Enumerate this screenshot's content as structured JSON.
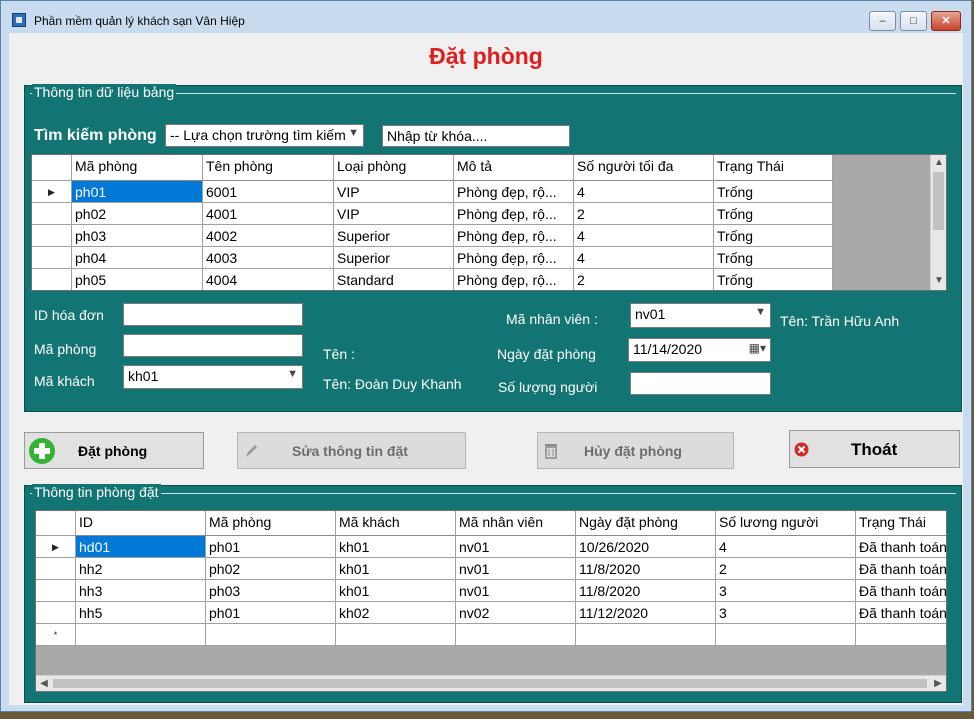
{
  "window": {
    "title": "Phần mềm quản lý khách sạn Vân Hiệp",
    "min": "–",
    "max": "□",
    "close": "✕"
  },
  "heading": "Đặt phòng",
  "group1": {
    "legend": "Thông tin dữ liệu  bảng",
    "search_label": "Tìm kiếm phòng",
    "search_field": "-- Lựa chọn trường tìm kiếm",
    "keyword": "Nhập từ khóa....",
    "rooms": {
      "headers": [
        "Mã phòng",
        "Tên phòng",
        "Loại phòng",
        "Mô tả",
        "Số người tối đa",
        "Trạng Thái"
      ],
      "rows": [
        [
          "ph01",
          "6001",
          "VIP",
          "Phòng đẹp, rộ...",
          "4",
          "Trống"
        ],
        [
          "ph02",
          "4001",
          "VIP",
          "Phòng đẹp, rộ...",
          "2",
          "Trống"
        ],
        [
          "ph03",
          "4002",
          "Superior",
          "Phòng đẹp, rộ...",
          "4",
          "Trống"
        ],
        [
          "ph04",
          "4003",
          "Superior",
          "Phòng đẹp, rộ...",
          "4",
          "Trống"
        ],
        [
          "ph05",
          "4004",
          "Standard",
          "Phòng đẹp, rộ...",
          "2",
          "Trống"
        ]
      ]
    },
    "form": {
      "invoice_id_label": "ID hóa đơn",
      "room_id_label": "Mã phòng",
      "customer_id_label": "Mã khách",
      "customer_id_value": "kh01",
      "room_name_label": "Tên :",
      "customer_name_label": "Tên: Đoàn Duy Khanh",
      "staff_id_label": "Mã nhân viên :",
      "staff_id_value": "nv01",
      "staff_name_label": "Tên: Trần Hữu Anh",
      "booking_date_label": "Ngày đặt phòng",
      "booking_date_value": "11/14/2020",
      "guests_label": "Số lượng người"
    }
  },
  "buttons": {
    "book": "Đặt phòng",
    "edit": "Sửa thông tin đặt",
    "cancel": "Hủy đặt phòng",
    "exit": "Thoát"
  },
  "group2": {
    "legend": "Thông tin phòng đặt",
    "bookings": {
      "headers": [
        "ID",
        "Mã phòng",
        "Mã khách",
        "Mã nhân viên",
        "Ngày đặt phòng",
        "Số lương người",
        "Trạng Thái"
      ],
      "rows": [
        [
          "hd01",
          "ph01",
          "kh01",
          "nv01",
          "10/26/2020",
          "4",
          "Đã thanh toán"
        ],
        [
          "hh2",
          "ph02",
          "kh01",
          "nv01",
          "11/8/2020",
          "2",
          "Đã thanh toán"
        ],
        [
          "hh3",
          "ph03",
          "kh01",
          "nv01",
          "11/8/2020",
          "3",
          "Đã thanh toán"
        ],
        [
          "hh5",
          "ph01",
          "kh02",
          "nv02",
          "11/12/2020",
          "3",
          "Đã thanh toán"
        ]
      ]
    }
  },
  "colors": {
    "panel": "#137573",
    "heading": "#e01e1e",
    "selection": "#0078d7"
  }
}
